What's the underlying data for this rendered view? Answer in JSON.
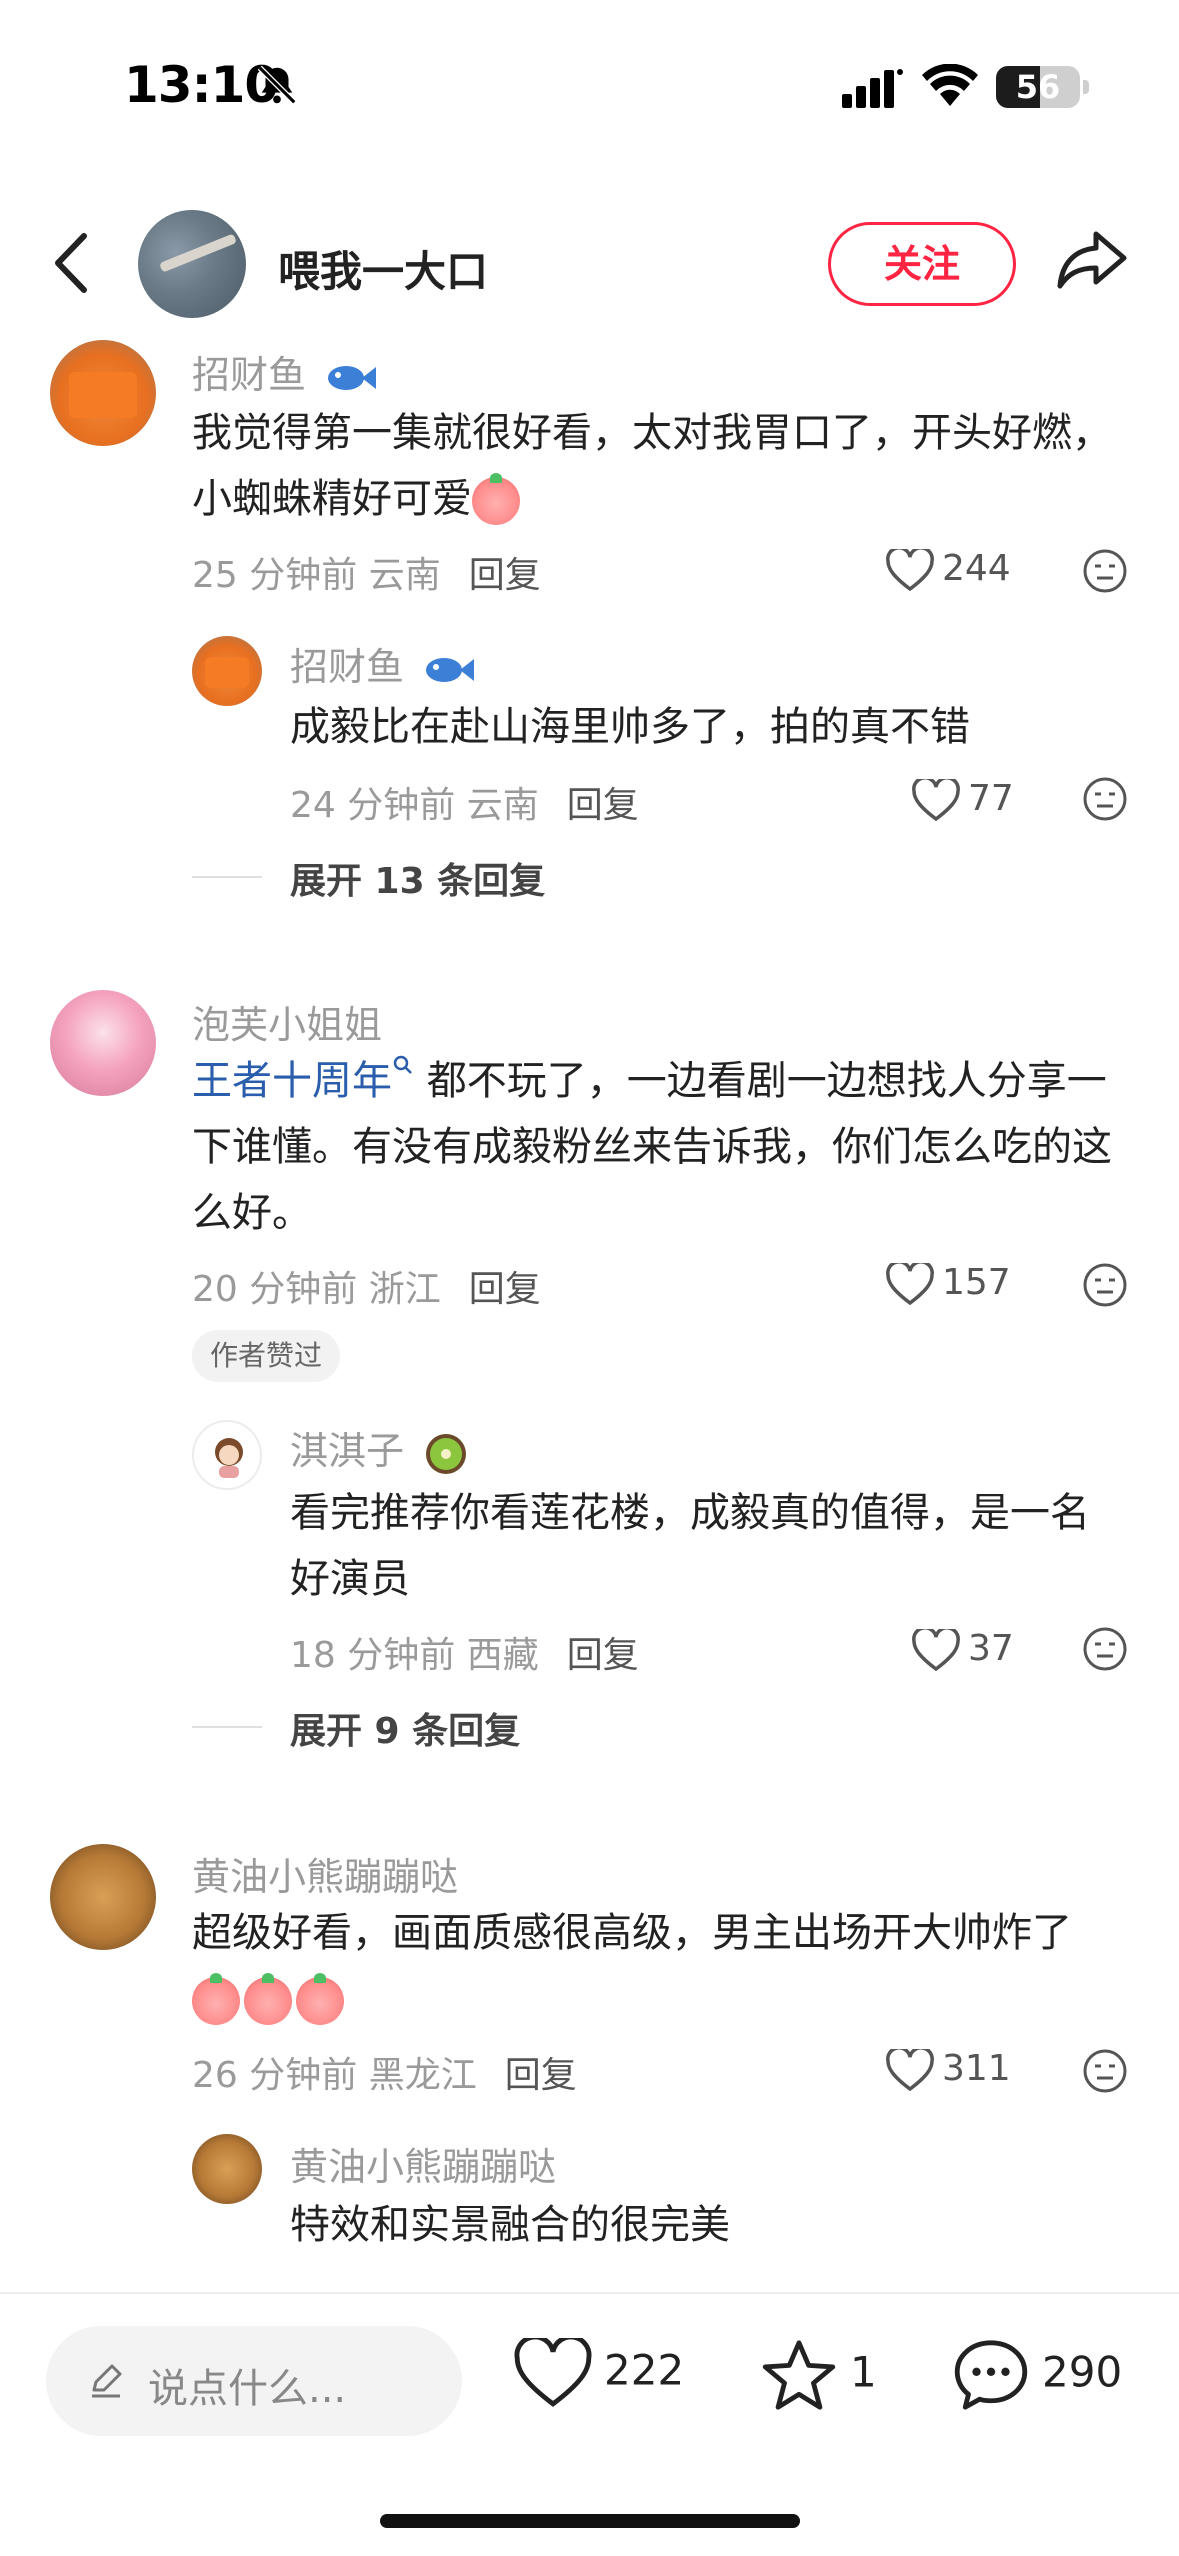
{
  "status_bar": {
    "time": "13:10",
    "battery": "56"
  },
  "header": {
    "author_name": "喂我一大口",
    "follow_label": "关注"
  },
  "comments": [
    {
      "user": "招财鱼",
      "text": "我觉得第一集就很好看，太对我胃口了，开头好燃，小蜘蛛精好可爱",
      "time": "25 分钟前",
      "location": "云南",
      "reply_label": "回复",
      "likes": "244",
      "replies": [
        {
          "user": "招财鱼",
          "text": "成毅比在赴山海里帅多了，拍的真不错",
          "time": "24 分钟前",
          "location": "云南",
          "reply_label": "回复",
          "likes": "77"
        }
      ],
      "expand_label": "展开 13 条回复"
    },
    {
      "user": "泡芙小姐姐",
      "topic": "王者十周年",
      "text": "都不玩了，一边看剧一边想找人分享一下谁懂。有没有成毅粉丝来告诉我，你们怎么吃的这么好。",
      "time": "20 分钟前",
      "location": "浙江",
      "reply_label": "回复",
      "likes": "157",
      "tag": "作者赞过",
      "replies": [
        {
          "user": "淇淇子",
          "text": "看完推荐你看莲花楼，成毅真的值得，是一名好演员",
          "time": "18 分钟前",
          "location": "西藏",
          "reply_label": "回复",
          "likes": "37"
        }
      ],
      "expand_label": "展开 9 条回复"
    },
    {
      "user": "黄油小熊蹦蹦哒",
      "text": "超级好看，画面质感很高级，男主出场开大帅炸了",
      "time": "26 分钟前",
      "location": "黑龙江",
      "reply_label": "回复",
      "likes": "311",
      "replies": [
        {
          "user": "黄油小熊蹦蹦哒",
          "text": "特效和实景融合的很完美"
        }
      ]
    }
  ],
  "bottom_bar": {
    "input_placeholder": "说点什么...",
    "likes": "222",
    "stars": "1",
    "comments": "290"
  }
}
